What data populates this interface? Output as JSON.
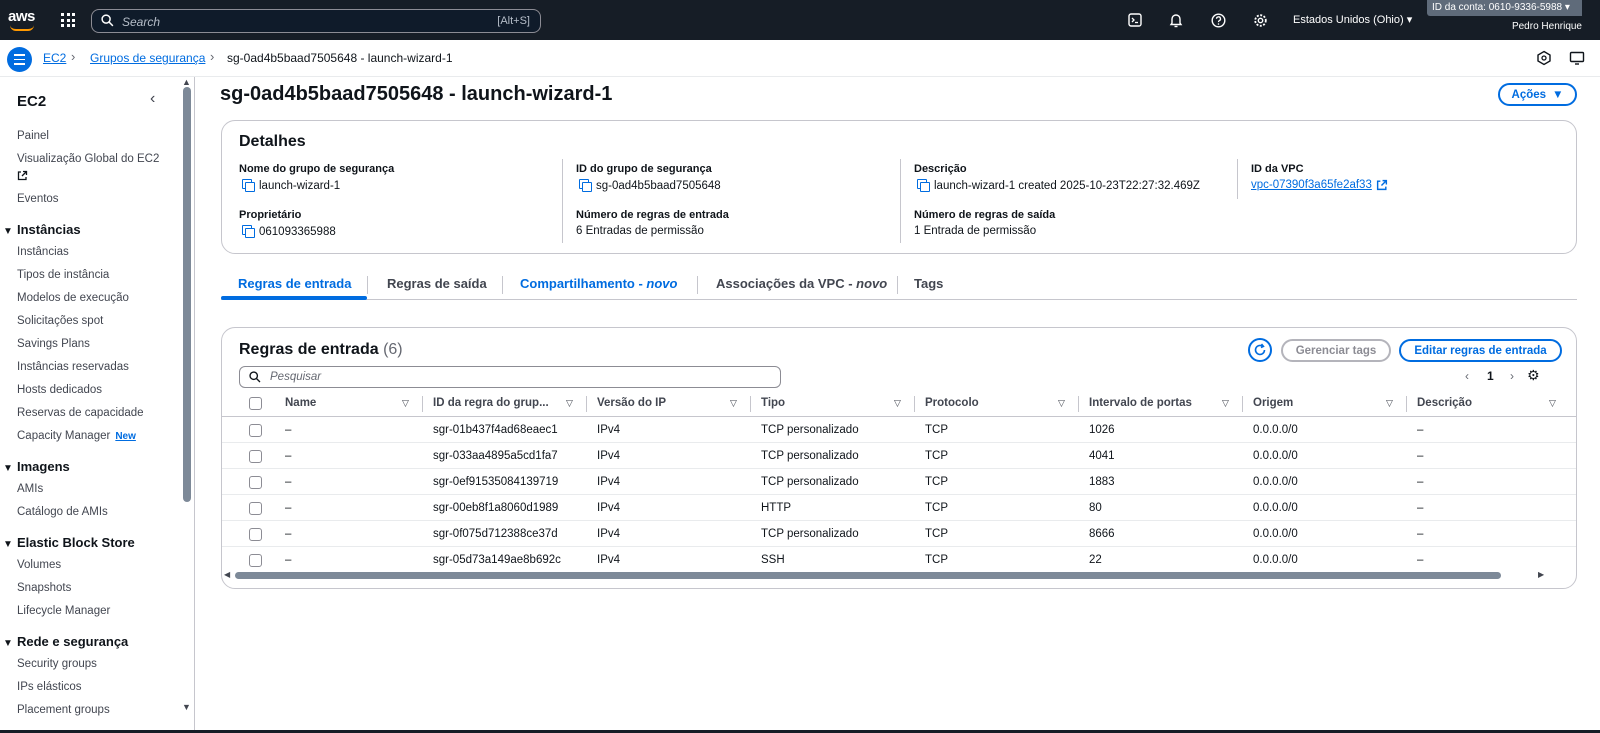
{
  "topbar": {
    "logo": "aws",
    "search_placeholder": "Search",
    "search_shortcut": "[Alt+S]",
    "region": "Estados Unidos (Ohio) ▾",
    "account": "ID da conta: 0610-9336-5988 ▾",
    "user": "Pedro Henrique",
    "icons": [
      "cloudshell-icon",
      "bell-icon",
      "help-icon",
      "gear-icon"
    ]
  },
  "breadcrumb": {
    "items": [
      "EC2",
      "Grupos de segurança",
      "sg-0ad4b5baad7505648 - launch-wizard-1"
    ]
  },
  "sidebar": {
    "title": "EC2",
    "top_items": [
      "Painel",
      "Visualização Global do EC2",
      "Eventos"
    ],
    "sections": [
      {
        "title": "Instâncias",
        "items": [
          "Instâncias",
          "Tipos de instância",
          "Modelos de execução",
          "Solicitações spot",
          "Savings Plans",
          "Instâncias reservadas",
          "Hosts dedicados",
          "Reservas de capacidade",
          "Capacity Manager"
        ]
      },
      {
        "title": "Imagens",
        "items": [
          "AMIs",
          "Catálogo de AMIs"
        ]
      },
      {
        "title": "Elastic Block Store",
        "items": [
          "Volumes",
          "Snapshots",
          "Lifecycle Manager"
        ]
      },
      {
        "title": "Rede e segurança",
        "items": [
          "Security groups",
          "IPs elásticos",
          "Placement groups"
        ]
      }
    ],
    "new_badge": "New"
  },
  "page": {
    "title": "sg-0ad4b5baad7505648 - launch-wizard-1",
    "actions_label": "Ações"
  },
  "details": {
    "heading": "Detalhes",
    "fields": {
      "name_label": "Nome do grupo de segurança",
      "name_value": "launch-wizard-1",
      "id_label": "ID do grupo de segurança",
      "id_value": "sg-0ad4b5baad7505648",
      "desc_label": "Descrição",
      "desc_value": "launch-wizard-1 created 2025-10-23T22:27:32.469Z",
      "vpc_label": "ID da VPC",
      "vpc_value": "vpc-07390f3a65fe2af33",
      "owner_label": "Proprietário",
      "owner_value": "061093365988",
      "inbound_label": "Número de regras de entrada",
      "inbound_value": "6 Entradas de permissão",
      "outbound_label": "Número de regras de saída",
      "outbound_value": "1 Entrada de permissão"
    }
  },
  "tabs": {
    "inbound": "Regras de entrada",
    "outbound": "Regras de saída",
    "sharing": "Compartilhamento - ",
    "sharing_new": "novo",
    "vpc_assoc": "Associações da VPC - ",
    "vpc_assoc_new": "novo",
    "tags": "Tags"
  },
  "rules": {
    "title": "Regras de entrada",
    "count": "(6)",
    "manage_tags": "Gerenciar tags",
    "edit_rules": "Editar regras de entrada",
    "filter_placeholder": "Pesquisar",
    "page": "1",
    "columns": [
      "Name",
      "ID da regra do grup...",
      "Versão do IP",
      "Tipo",
      "Protocolo",
      "Intervalo de portas",
      "Origem",
      "Descrição"
    ],
    "rows": [
      [
        "–",
        "sgr-01b437f4ad68eaec1",
        "IPv4",
        "TCP personalizado",
        "TCP",
        "1026",
        "0.0.0.0/0",
        "–"
      ],
      [
        "–",
        "sgr-033aa4895a5cd1fa7",
        "IPv4",
        "TCP personalizado",
        "TCP",
        "4041",
        "0.0.0.0/0",
        "–"
      ],
      [
        "–",
        "sgr-0ef91535084139719",
        "IPv4",
        "TCP personalizado",
        "TCP",
        "1883",
        "0.0.0.0/0",
        "–"
      ],
      [
        "–",
        "sgr-00eb8f1a8060d1989",
        "IPv4",
        "HTTP",
        "TCP",
        "80",
        "0.0.0.0/0",
        "–"
      ],
      [
        "–",
        "sgr-0f075d712388ce37d",
        "IPv4",
        "TCP personalizado",
        "TCP",
        "8666",
        "0.0.0.0/0",
        "–"
      ],
      [
        "–",
        "sgr-05d73a149ae8b692c",
        "IPv4",
        "SSH",
        "TCP",
        "22",
        "0.0.0.0/0",
        "–"
      ]
    ]
  }
}
